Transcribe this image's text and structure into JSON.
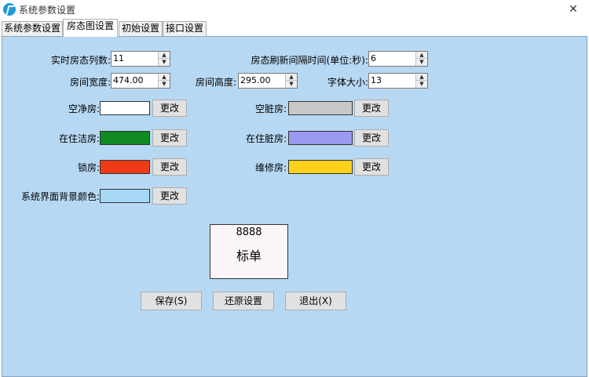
{
  "window": {
    "title": "系统参数设置",
    "close_symbol": "✕"
  },
  "tabs": [
    {
      "label": "系统参数设置",
      "active": false
    },
    {
      "label": "房态图设置",
      "active": true
    },
    {
      "label": "初始设置",
      "active": false
    },
    {
      "label": "接口设置",
      "active": false
    }
  ],
  "fields": {
    "realtime_columns": {
      "label": "实时房态列数:",
      "value": "11"
    },
    "refresh_interval": {
      "label": "房态刷新间隔时间(单位:秒):",
      "value": "6"
    },
    "room_width": {
      "label": "房间宽度:",
      "value": "474.00"
    },
    "room_height": {
      "label": "房间高度:",
      "value": "295.00"
    },
    "font_size": {
      "label": "字体大小:",
      "value": "13"
    }
  },
  "colors": [
    {
      "key": "vacant_clean",
      "label": "空净房:",
      "color": "#ffffff"
    },
    {
      "key": "vacant_dirty",
      "label": "空脏房:",
      "color": "#c8c8c8"
    },
    {
      "key": "occupied_clean",
      "label": "在住洁房:",
      "color": "#0f8a22"
    },
    {
      "key": "occupied_dirty",
      "label": "在住脏房:",
      "color": "#9a9af0"
    },
    {
      "key": "locked",
      "label": "锁房:",
      "color": "#f03a17"
    },
    {
      "key": "maintenance",
      "label": "维修房:",
      "color": "#ffd11a"
    },
    {
      "key": "background",
      "label": "系统界面背景颜色:",
      "color": "#a6d8f5"
    }
  ],
  "change_label": "更改",
  "preview": {
    "number": "8888",
    "caption": "标单"
  },
  "actions": {
    "save": "保存(S)",
    "restore": "还原设置",
    "exit": "退出(X)"
  },
  "theme": {
    "panel_bg": "#b7d8f3"
  }
}
